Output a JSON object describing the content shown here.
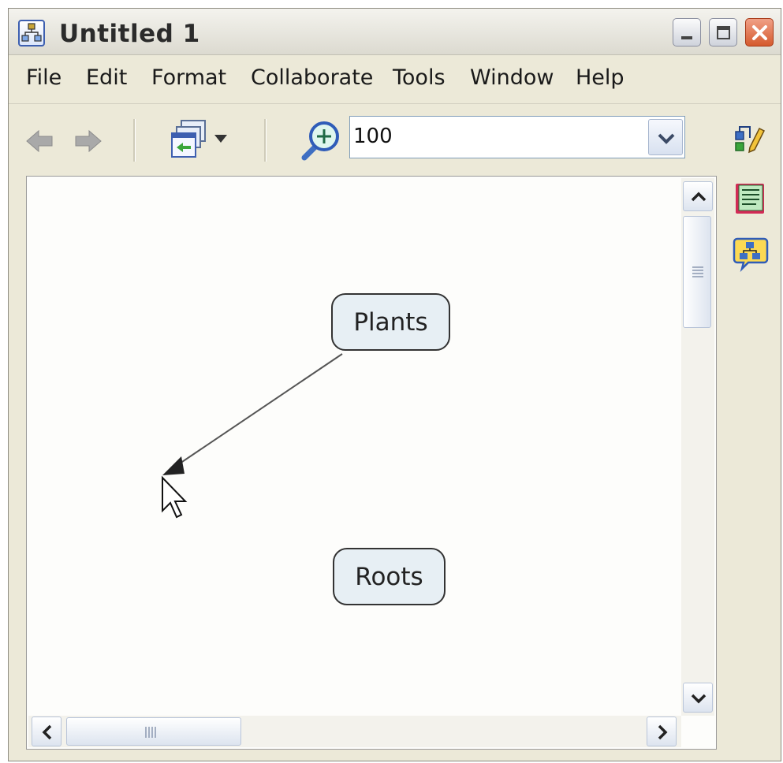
{
  "window": {
    "title": "Untitled 1"
  },
  "menu": {
    "items": [
      "File",
      "Edit",
      "Format",
      "Collaborate",
      "Tools",
      "Window",
      "Help"
    ]
  },
  "toolbar": {
    "back_icon": "back-arrow-icon",
    "forward_icon": "forward-arrow-icon",
    "view_icon": "view-mode-icon",
    "zoom_icon": "zoom-icon",
    "zoom_value": "100"
  },
  "concept_map": {
    "concepts": [
      {
        "id": "plants",
        "label": "Plants"
      },
      {
        "id": "roots",
        "label": "Roots"
      }
    ],
    "links": [
      {
        "from": "plants",
        "to": "pointer",
        "state": "being-drawn"
      }
    ]
  },
  "side_panel": {
    "icons": [
      "styles-icon",
      "notes-icon",
      "concept-map-icon"
    ]
  },
  "colors": {
    "concept_fill": "#e7eff4",
    "close_button": "#d55a2e",
    "window_frame": "#ece9d8"
  }
}
